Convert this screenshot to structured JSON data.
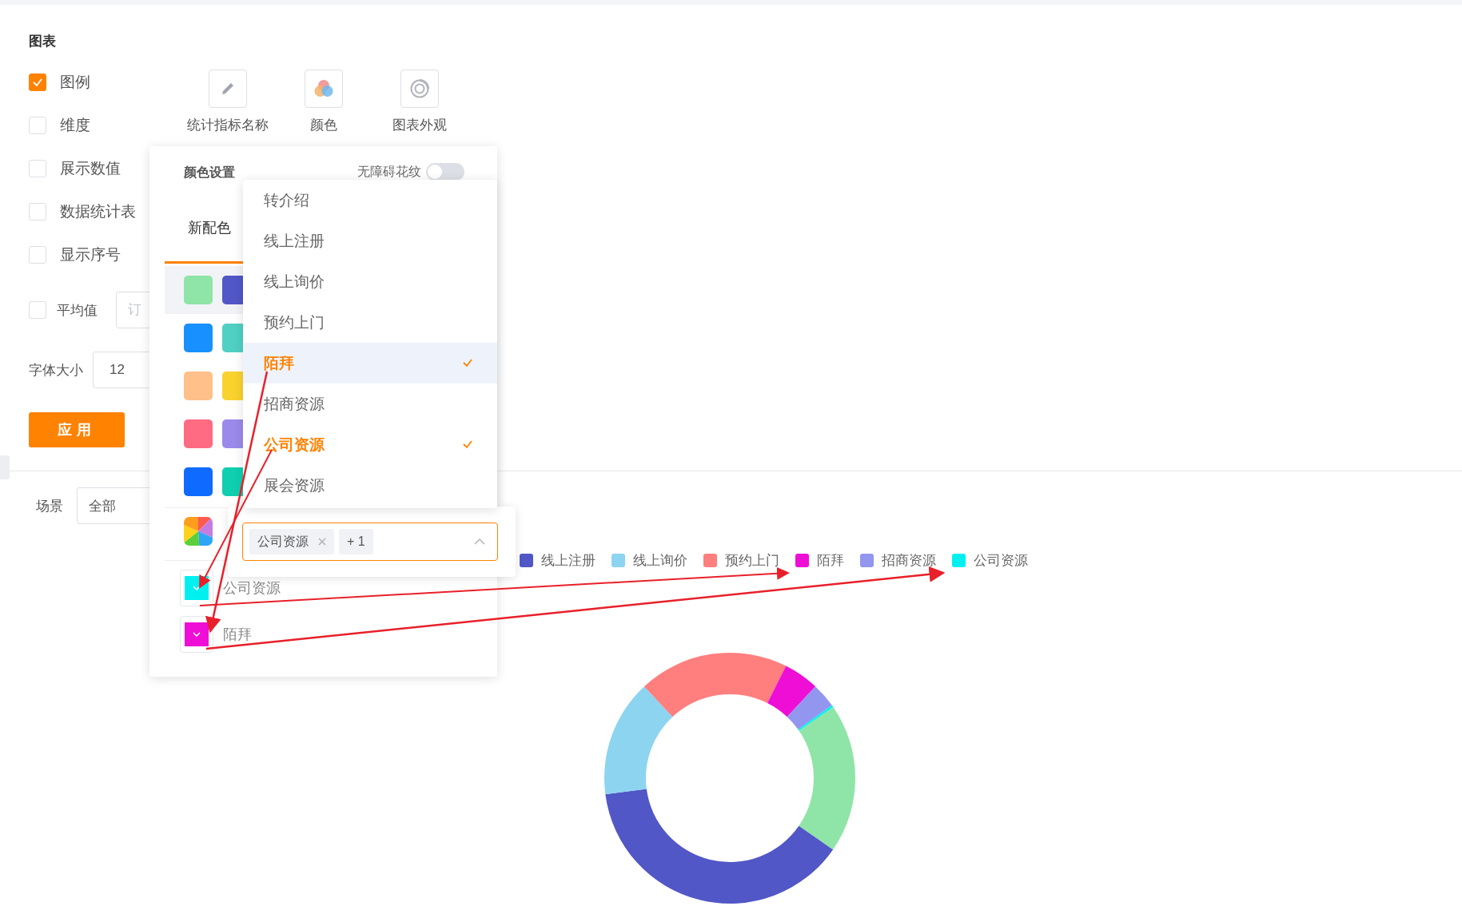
{
  "section_title": "图表",
  "options": [
    {
      "label": "图例",
      "checked": true
    },
    {
      "label": "维度",
      "checked": false
    },
    {
      "label": "展示数值",
      "checked": false
    },
    {
      "label": "数据统计表",
      "checked": false
    },
    {
      "label": "显示序号",
      "checked": false
    }
  ],
  "average": {
    "label": "平均值",
    "checked": false,
    "placeholder": "订"
  },
  "font_size": {
    "label": "字体大小",
    "value": "12"
  },
  "apply_button": "应用",
  "tools": [
    {
      "label": "统计指标名称",
      "kind": "pencil"
    },
    {
      "label": "颜色",
      "kind": "palette"
    },
    {
      "label": "图表外观",
      "kind": "ring"
    }
  ],
  "scene": {
    "label": "场景",
    "value": "全部"
  },
  "color_popup": {
    "title": "颜色设置",
    "pattern_toggle": {
      "label": "无障碍花纹",
      "on": false
    },
    "tabs": [
      {
        "label": "新配色",
        "selected": true
      }
    ],
    "palettes": [
      {
        "selected": true,
        "swatches": [
          {
            "color": "#8fe5a8"
          },
          {
            "color": "#5157c6"
          }
        ]
      },
      {
        "selected": false,
        "swatches": [
          {
            "color": "#1890ff"
          },
          {
            "color": "#4fd0c3"
          }
        ]
      },
      {
        "selected": false,
        "swatches": [
          {
            "color": "#ffc08a"
          },
          {
            "color": "#fad22e"
          }
        ]
      },
      {
        "selected": false,
        "swatches": [
          {
            "color": "#ff6b82"
          },
          {
            "color": "#9b8aea"
          }
        ]
      },
      {
        "selected": false,
        "swatches": [
          {
            "color": "#0f6bff"
          },
          {
            "color": "#0fcfb0"
          }
        ]
      }
    ],
    "category_select": {
      "tags": [
        "公司资源"
      ],
      "more": "+ 1",
      "expanded": true
    },
    "category_options": [
      {
        "label": "转介绍",
        "selected": false,
        "active": false
      },
      {
        "label": "线上注册",
        "selected": false,
        "active": false
      },
      {
        "label": "线上询价",
        "selected": false,
        "active": false
      },
      {
        "label": "预约上门",
        "selected": false,
        "active": false
      },
      {
        "label": "陌拜",
        "selected": true,
        "active": true
      },
      {
        "label": "招商资源",
        "selected": false,
        "active": false
      },
      {
        "label": "公司资源",
        "selected": true,
        "active": false
      },
      {
        "label": "展会资源",
        "selected": false,
        "active": false
      }
    ],
    "assigned": [
      {
        "label": "公司资源",
        "color": "#00f0f0"
      },
      {
        "label": "陌拜",
        "color": "#ee0ed6"
      }
    ]
  },
  "legend": [
    {
      "label": "线上注册",
      "color": "#5157c6"
    },
    {
      "label": "线上询价",
      "color": "#8dd4f0"
    },
    {
      "label": "预约上门",
      "color": "#ff7e7e"
    },
    {
      "label": "陌拜",
      "color": "#ee0ed6"
    },
    {
      "label": "招商资源",
      "color": "#9396ee"
    },
    {
      "label": "公司资源",
      "color": "#00f0f0"
    }
  ]
}
